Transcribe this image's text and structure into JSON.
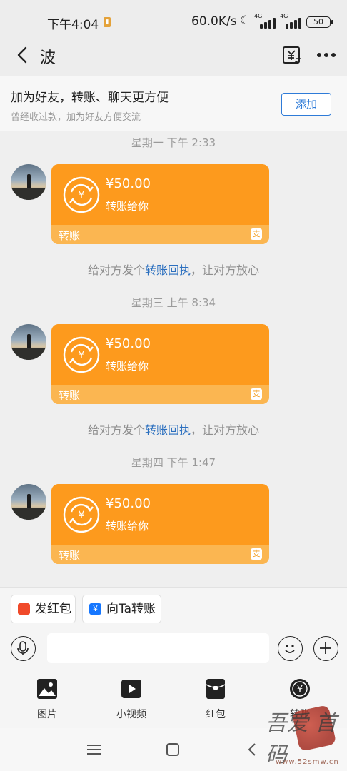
{
  "status_bar": {
    "time": "下午4:04",
    "net_speed": "60.0K/s",
    "net_type_1": "4G",
    "net_type_2": "4G",
    "battery": "50"
  },
  "header": {
    "title": "波"
  },
  "banner": {
    "title": "加为好友，转账、聊天更方便",
    "subtitle": "曾经收过款，加为好友方便交流",
    "add_label": "添加"
  },
  "messages": [
    {
      "timestamp": "星期一 下午 2:33",
      "amount": "¥50.00",
      "desc": "转账给你",
      "label": "转账",
      "note_prefix": "给对方发个",
      "note_link": "转账回执",
      "note_suffix": "，让对方放心"
    },
    {
      "timestamp": "星期三 上午 8:34",
      "amount": "¥50.00",
      "desc": "转账给你",
      "label": "转账",
      "note_prefix": "给对方发个",
      "note_link": "转账回执",
      "note_suffix": "，让对方放心"
    },
    {
      "timestamp": "星期四 下午 1:47",
      "amount": "¥50.00",
      "desc": "转账给你",
      "label": "转账",
      "note_prefix": "",
      "note_link": "",
      "note_suffix": ""
    }
  ],
  "quick_actions": {
    "red_packet": "发红包",
    "transfer": "向Ta转账"
  },
  "tools": [
    {
      "label": "图片",
      "icon": "image-icon"
    },
    {
      "label": "小视频",
      "icon": "video-icon"
    },
    {
      "label": "红包",
      "icon": "red-packet-icon"
    },
    {
      "label": "转账",
      "icon": "transfer-icon"
    }
  ],
  "watermark": {
    "brush": "吾爱 首码",
    "url": "www.52smw.cn"
  },
  "colors": {
    "card_orange": "#fd9a1d",
    "card_footer": "#fbb651",
    "link_blue": "#2b6fbf",
    "add_button_blue": "#2e7bd8"
  }
}
